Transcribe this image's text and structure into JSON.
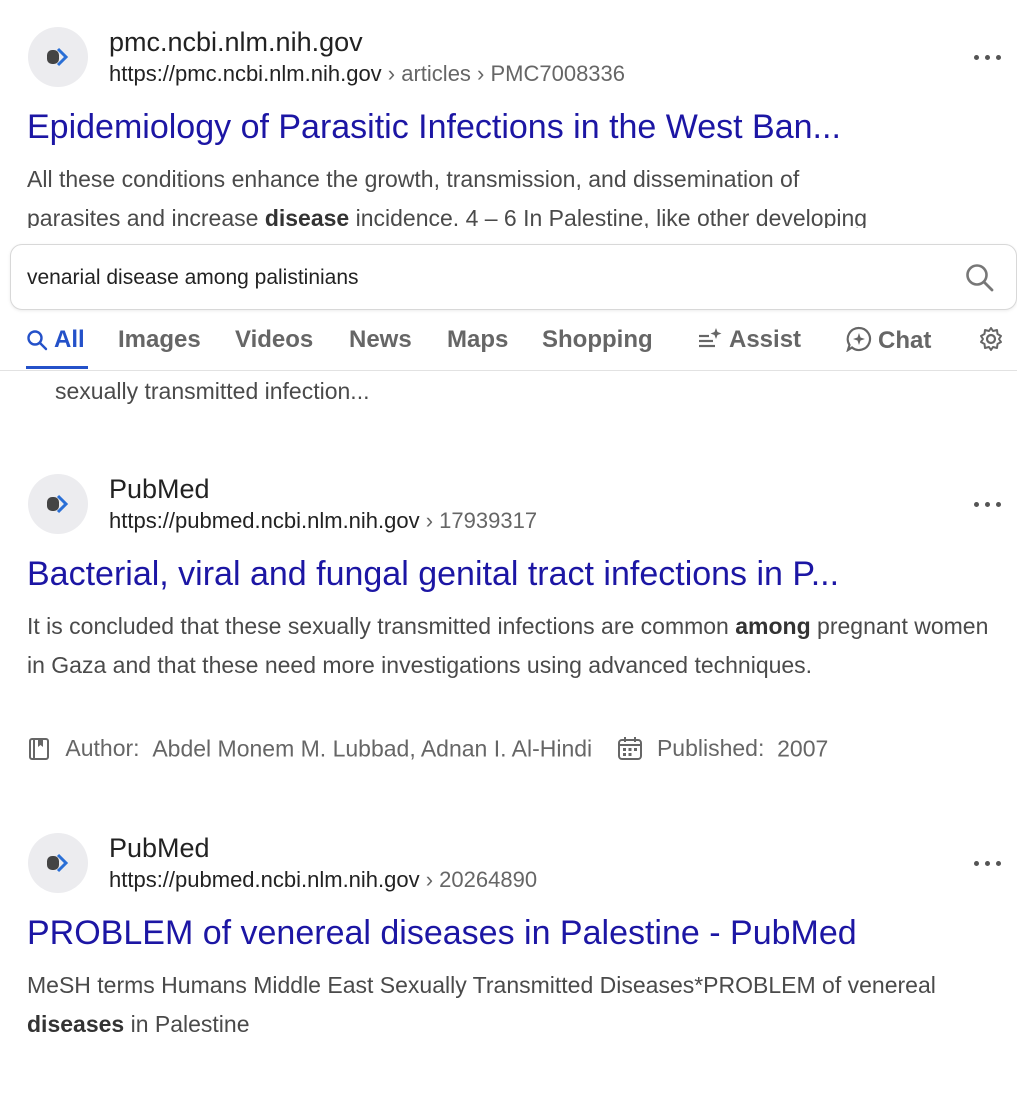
{
  "results": [
    {
      "site_name": "pmc.ncbi.nlm.nih.gov",
      "url_base": "https://pmc.ncbi.nlm.nih.gov",
      "url_path": " › articles › PMC7008336",
      "title": "Epidemiology of Parasitic Infections in the West Ban...",
      "snippet_1": "All these conditions enhance the growth, transmission, and dissemination of",
      "snippet_2_pre": "parasites and increase ",
      "snippet_2_bold": "disease",
      "snippet_2_post": " incidence. 4 – 6 In Palestine, like other developing",
      "snippet_tail": "sexually transmitted infection..."
    },
    {
      "site_name": "PubMed",
      "url_base": "https://pubmed.ncbi.nlm.nih.gov",
      "url_path": " › 17939317",
      "title": "Bacterial, viral and fungal genital tract infections in P...",
      "snippet_pre": "It is concluded that these sexually transmitted infections are common ",
      "snippet_bold": "among",
      "snippet_post": " pregnant women in Gaza and that these need more investigations using advanced techniques.",
      "author_label": "Author:",
      "author_value": "Abdel Monem M. Lubbad, Adnan I. Al-Hindi",
      "published_label": "Published:",
      "published_value": "2007"
    },
    {
      "site_name": "PubMed",
      "url_base": "https://pubmed.ncbi.nlm.nih.gov",
      "url_path": " › 20264890",
      "title": "PROBLEM of venereal diseases in Palestine - PubMed",
      "snippet_pre": "MeSH terms Humans Middle East Sexually Transmitted Diseases*PROBLEM of venereal ",
      "snippet_bold": "diseases",
      "snippet_post": " in Palestine"
    }
  ],
  "search": {
    "query": "venarial disease among palistinians"
  },
  "tabs": {
    "all": "All",
    "images": "Images",
    "videos": "Videos",
    "news": "News",
    "maps": "Maps",
    "shopping": "Shopping",
    "assist": "Assist",
    "chat": "Chat"
  },
  "colors": {
    "title_link": "#1c16a4",
    "active_tab": "#2451c9"
  }
}
